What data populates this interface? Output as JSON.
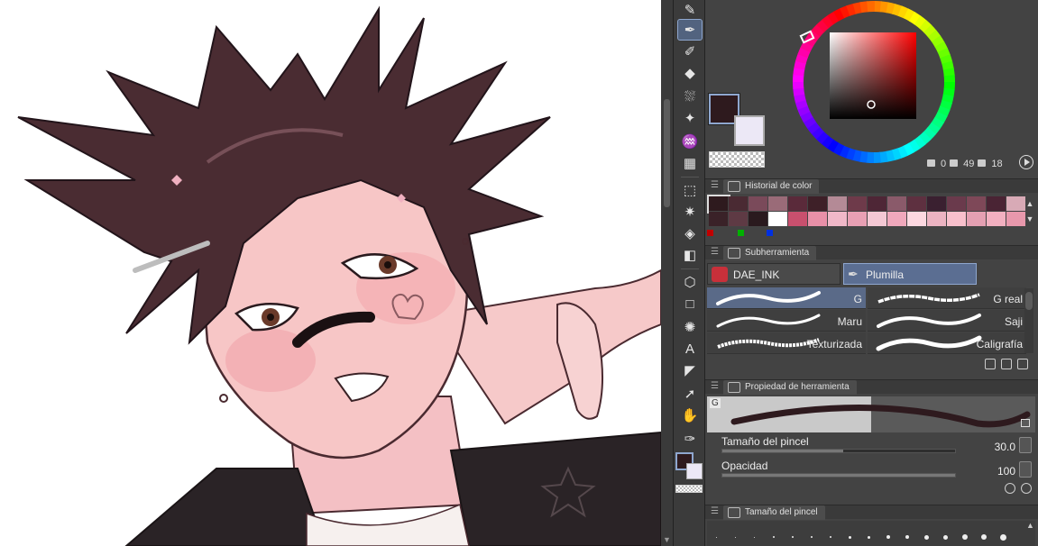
{
  "panels": {
    "color_history": {
      "title": "Historial de color"
    },
    "subtool": {
      "title": "Subherramienta"
    },
    "tool_property": {
      "title": "Propiedad de herramienta"
    },
    "brush_size": {
      "title": "Tamaño del pincel"
    }
  },
  "color": {
    "main": "#2e1a1e",
    "sub": "#ece8f6",
    "hsv": {
      "h": "0",
      "s": "49",
      "v": "18"
    }
  },
  "history_colors": [
    "#2e1a1e",
    "#4a2a33",
    "#7a4a5a",
    "#9a6b78",
    "#5a2a3a",
    "#3e2028",
    "#b48a96",
    "#6e3a4a",
    "#4e2636",
    "#8a5a6a",
    "#5e3040",
    "#3a2030",
    "#6a3a4c",
    "#7e4858",
    "#4a2434",
    "#d8aab6",
    "#3a2228",
    "#5e3a44",
    "#2a1a1e",
    "#ffffff",
    "#c8506e",
    "#e890a8",
    "#f0b8c8",
    "#e8a0b4",
    "#f4c8d4",
    "#f0a8bc",
    "#fcd8e0",
    "#ecb4c2",
    "#f8c0cc",
    "#e4a0b2",
    "#f2b0c0",
    "#e898ac"
  ],
  "subtool": {
    "groups": [
      {
        "label": "DAE_INK"
      },
      {
        "label": "Plumilla"
      }
    ],
    "brushes": [
      {
        "name": "G"
      },
      {
        "name": "G real"
      },
      {
        "name": "Maru"
      },
      {
        "name": "Saji"
      },
      {
        "name": "Texturizada"
      },
      {
        "name": "Caligrafía"
      }
    ]
  },
  "tool_property": {
    "preview_label": "G",
    "brush_size": {
      "label": "Tamaño del pincel",
      "value": "30.0",
      "fraction": 0.52
    },
    "opacity": {
      "label": "Opacidad",
      "value": "100",
      "fraction": 1.0
    }
  },
  "icons": {
    "toolbar": [
      "pen-icon",
      "pen-icon",
      "marker-icon",
      "eraser-icon",
      "airbrush-icon",
      "sparkle-icon",
      "blend-icon",
      "grid-icon",
      "lasso-icon",
      "magic-wand-icon",
      "fill-icon",
      "gradient-icon",
      "3d-icon",
      "rectangle-icon",
      "burst-icon",
      "text-icon",
      "ruler-icon",
      "object-select-icon",
      "hand-icon",
      "eyedropper-icon"
    ]
  }
}
